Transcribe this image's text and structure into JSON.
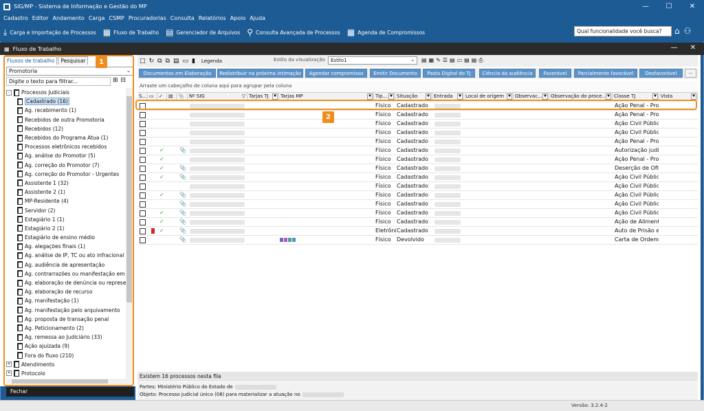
{
  "window": {
    "title": "SIG/MP - Sistema de Informação e Gestão do MP"
  },
  "menu": [
    "Cadastro",
    "Editor",
    "Andamento",
    "Carga",
    "CSMP",
    "Procuradorias",
    "Consulta",
    "Relatórios",
    "Apoio",
    "Ajuda"
  ],
  "toolbar": [
    {
      "label": "Carga e Importação de Processos",
      "icon": "download-icon"
    },
    {
      "label": "Fluxo de Trabalho",
      "icon": "workflow-icon"
    },
    {
      "label": "Gerenciador de Arquivos",
      "icon": "file-manager-icon"
    },
    {
      "label": "Consulta Avançada de Processos",
      "icon": "advanced-search-icon"
    },
    {
      "label": "Agenda de Compromissos",
      "icon": "calendar-icon"
    }
  ],
  "search": {
    "placeholder": "Qual funcionalidade você busca?"
  },
  "panel": {
    "title": "Fluxo de Trabalho"
  },
  "left": {
    "tabs": [
      "Fluxos de trabalho",
      "Pesquisar"
    ],
    "dropdown_value": "Promotoria",
    "filter_placeholder": "Digite o texto para filtrar...",
    "root": "Processos Judiciais",
    "items": [
      "Cadastrado (16)",
      "Ag. recebimento (1)",
      "Recebidos de outra Promotoria",
      "Recebidos (12)",
      "Recebidos do Programa Atua (1)",
      "Processos eletrônicos recebidos",
      "Ag. análise do Promotor (5)",
      "Ag. correção do Promotor (7)",
      "Ag. correção do Promotor - Urgentes",
      "Assistente 1 (32)",
      "Assistente 2 (1)",
      "MP-Residente (4)",
      "Servidor (2)",
      "Estagiário 1 (1)",
      "Estagiário 2 (1)",
      "Estagiário de ensino médio",
      "Ag. alegações finais (1)",
      "Ag. análise de IP, TC ou ato infracional",
      "Ag. audiência de apresentação",
      "Ag. contrarrazões ou manifestação em",
      "Ag. elaboração de denúncia ou represe",
      "Ag. elaboração de recurso",
      "Ag. manifestação (1)",
      "Ag. manifestação pelo arquivamento",
      "Ag. proposta de transação penal",
      "Ag. Peticionamento (2)",
      "Ag. remessa ao Judiciário (33)",
      "Ação ajuizada (9)",
      "Fora do fluxo (210)"
    ],
    "other_roots": [
      "Atendimento",
      "Protocolo"
    ],
    "close": "Fechar"
  },
  "right": {
    "legend": "Legenda",
    "style_label": "Estilo da visualização",
    "style_value": "Estilo1",
    "buttons": [
      "Documentos em Elaboração",
      "Redistribuir na próxima intimação",
      "Agendar compromisso",
      "Emitir Documento",
      "Pasta Digital do TJ",
      "Ciência da audiência",
      "Favorável",
      "Parcialmente favorável",
      "Desfavorável"
    ],
    "more": "...",
    "group_hint": "Arraste um cabeçalho de coluna aqui para agrupar pela coluna",
    "columns": [
      "S...",
      "",
      "",
      "",
      "",
      "Nº SIG",
      "Tarjas TJ",
      "Tarjas MP",
      "Tip...",
      "Situação",
      "Entrada",
      "Local de origem",
      "Observac...",
      "Observação do proce...",
      "Classe TJ",
      "Vista"
    ],
    "rows": [
      {
        "tipo": "Físico",
        "sit": "Cadastrado",
        "classe": "Ação Penal - Pro",
        "ok": false,
        "att": false,
        "flag": false,
        "tags": false
      },
      {
        "tipo": "Físico",
        "sit": "Cadastrado",
        "classe": "Ação Penal - Pro",
        "ok": false,
        "att": false,
        "flag": false,
        "tags": false
      },
      {
        "tipo": "Físico",
        "sit": "Cadastrado",
        "classe": "Ação Civil Pública",
        "ok": false,
        "att": false,
        "flag": false,
        "tags": false
      },
      {
        "tipo": "Físico",
        "sit": "Cadastrado",
        "classe": "Ação Civil Pública",
        "ok": false,
        "att": false,
        "flag": false,
        "tags": false
      },
      {
        "tipo": "Físico",
        "sit": "Cadastrado",
        "classe": "Ação Penal - Pro",
        "ok": false,
        "att": false,
        "flag": false,
        "tags": false
      },
      {
        "tipo": "Físico",
        "sit": "Cadastrado",
        "classe": "Autorização judic",
        "ok": true,
        "att": true,
        "flag": false,
        "tags": false
      },
      {
        "tipo": "Físico",
        "sit": "Cadastrado",
        "classe": "Ação Penal - Pro",
        "ok": true,
        "att": false,
        "flag": false,
        "tags": false
      },
      {
        "tipo": "Físico",
        "sit": "Cadastrado",
        "classe": "Deserção de Ofic",
        "ok": true,
        "att": true,
        "flag": false,
        "tags": false
      },
      {
        "tipo": "Físico",
        "sit": "Cadastrado",
        "classe": "Ação Civil Pública",
        "ok": true,
        "att": true,
        "flag": false,
        "tags": false
      },
      {
        "tipo": "Físico",
        "sit": "Cadastrado",
        "classe": "Ação Civil Pública",
        "ok": false,
        "att": false,
        "flag": false,
        "tags": false
      },
      {
        "tipo": "Físico",
        "sit": "Cadastrado",
        "classe": "Ação Civil Pública",
        "ok": true,
        "att": true,
        "flag": false,
        "tags": false
      },
      {
        "tipo": "Físico",
        "sit": "Cadastrado",
        "classe": "Ação Civil Pública",
        "ok": false,
        "att": true,
        "flag": false,
        "tags": false
      },
      {
        "tipo": "Físico",
        "sit": "Cadastrado",
        "classe": "Ação Civil Pública",
        "ok": true,
        "att": true,
        "flag": false,
        "tags": false
      },
      {
        "tipo": "Físico",
        "sit": "Cadastrado",
        "classe": "Ação de Alimento",
        "ok": true,
        "att": true,
        "flag": false,
        "tags": false
      },
      {
        "tipo": "Eletrôni",
        "sit": "Cadastrado",
        "classe": "Auto de Prisão e",
        "ok": true,
        "att": true,
        "flag": true,
        "tags": false
      },
      {
        "tipo": "Físico",
        "sit": "Devolvido",
        "classe": "Carta de Ordem",
        "ok": false,
        "att": true,
        "flag": false,
        "tags": true
      }
    ],
    "status": "Existem 16 processos nesta fila",
    "partes_label": "Partes: Ministério Público do Estado de",
    "objeto_label": "Objeto: Processo judicial único (08) para materializar a atuação no",
    "version": "Versão: 3.2.4-2"
  },
  "callouts": [
    "1",
    "2"
  ],
  "colors": {
    "titlebar": "#1d5b95",
    "button": "#5b93c8",
    "highlight": "#f08c1c",
    "check": "#2f9b2f",
    "flag": "#dd2222"
  }
}
